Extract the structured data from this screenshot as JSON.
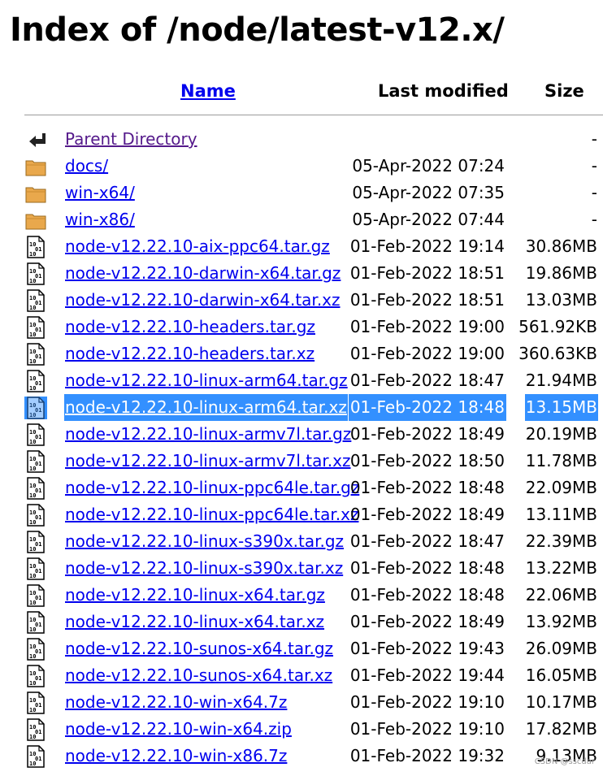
{
  "page": {
    "title": "Index of /node/latest-v12.x/"
  },
  "columns": {
    "name": "Name",
    "last_modified": "Last modified",
    "size": "Size"
  },
  "rows": [
    {
      "name": "Parent Directory",
      "date": "",
      "size": "-",
      "icon": "back-icon"
    },
    {
      "name": "docs/",
      "date": "05-Apr-2022 07:24",
      "size": "-",
      "icon": "folder-icon"
    },
    {
      "name": "win-x64/",
      "date": "05-Apr-2022 07:35",
      "size": "-",
      "icon": "folder-icon"
    },
    {
      "name": "win-x86/",
      "date": "05-Apr-2022 07:44",
      "size": "-",
      "icon": "folder-icon"
    },
    {
      "name": "node-v12.22.10-aix-ppc64.tar.gz",
      "date": "01-Feb-2022 19:14",
      "size": "30.86MB",
      "icon": "binary-file-icon"
    },
    {
      "name": "node-v12.22.10-darwin-x64.tar.gz",
      "date": "01-Feb-2022 18:51",
      "size": "19.86MB",
      "icon": "binary-file-icon"
    },
    {
      "name": "node-v12.22.10-darwin-x64.tar.xz",
      "date": "01-Feb-2022 18:51",
      "size": "13.03MB",
      "icon": "binary-file-icon"
    },
    {
      "name": "node-v12.22.10-headers.tar.gz",
      "date": "01-Feb-2022 19:00",
      "size": "561.92KB",
      "icon": "binary-file-icon"
    },
    {
      "name": "node-v12.22.10-headers.tar.xz",
      "date": "01-Feb-2022 19:00",
      "size": "360.63KB",
      "icon": "binary-file-icon"
    },
    {
      "name": "node-v12.22.10-linux-arm64.tar.gz",
      "date": "01-Feb-2022 18:47",
      "size": "21.94MB",
      "icon": "binary-file-icon"
    },
    {
      "name": "node-v12.22.10-linux-arm64.tar.xz",
      "date": "01-Feb-2022 18:48",
      "size": "13.15MB",
      "icon": "binary-file-icon"
    },
    {
      "name": "node-v12.22.10-linux-armv7l.tar.gz",
      "date": "01-Feb-2022 18:49",
      "size": "20.19MB",
      "icon": "binary-file-icon"
    },
    {
      "name": "node-v12.22.10-linux-armv7l.tar.xz",
      "date": "01-Feb-2022 18:50",
      "size": "11.78MB",
      "icon": "binary-file-icon"
    },
    {
      "name": "node-v12.22.10-linux-ppc64le.tar.gz",
      "date": "01-Feb-2022 18:48",
      "size": "22.09MB",
      "icon": "binary-file-icon"
    },
    {
      "name": "node-v12.22.10-linux-ppc64le.tar.xz",
      "date": "01-Feb-2022 18:49",
      "size": "13.11MB",
      "icon": "binary-file-icon"
    },
    {
      "name": "node-v12.22.10-linux-s390x.tar.gz",
      "date": "01-Feb-2022 18:47",
      "size": "22.39MB",
      "icon": "binary-file-icon"
    },
    {
      "name": "node-v12.22.10-linux-s390x.tar.xz",
      "date": "01-Feb-2022 18:48",
      "size": "13.22MB",
      "icon": "binary-file-icon"
    },
    {
      "name": "node-v12.22.10-linux-x64.tar.gz",
      "date": "01-Feb-2022 18:48",
      "size": "22.06MB",
      "icon": "binary-file-icon"
    },
    {
      "name": "node-v12.22.10-linux-x64.tar.xz",
      "date": "01-Feb-2022 18:49",
      "size": "13.92MB",
      "icon": "binary-file-icon"
    },
    {
      "name": "node-v12.22.10-sunos-x64.tar.gz",
      "date": "01-Feb-2022 19:43",
      "size": "26.09MB",
      "icon": "binary-file-icon"
    },
    {
      "name": "node-v12.22.10-sunos-x64.tar.xz",
      "date": "01-Feb-2022 19:44",
      "size": "16.05MB",
      "icon": "binary-file-icon"
    },
    {
      "name": "node-v12.22.10-win-x64.7z",
      "date": "01-Feb-2022 19:10",
      "size": "10.17MB",
      "icon": "binary-file-icon"
    },
    {
      "name": "node-v12.22.10-win-x64.zip",
      "date": "01-Feb-2022 19:10",
      "size": "17.82MB",
      "icon": "binary-file-icon"
    },
    {
      "name": "node-v12.22.10-win-x86.7z",
      "date": "01-Feb-2022 19:32",
      "size": "9.13MB",
      "icon": "binary-file-icon"
    }
  ],
  "selected_row": "node-v12.22.10-linux-arm64.tar.xz",
  "colors": {
    "link": "#0000ee",
    "visited": "#551a8b",
    "selection": "#3390ff",
    "folder": "#e9a84c"
  },
  "watermark": "CSDN @sscdar"
}
